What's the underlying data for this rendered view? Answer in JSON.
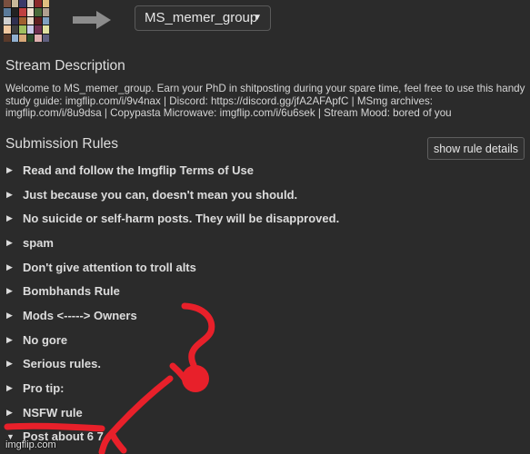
{
  "header": {
    "stream_name": "MS_memer_group"
  },
  "thumbnail_colors": [
    "#7a5040",
    "#c9b89a",
    "#3a3a6a",
    "#d8d0c0",
    "#8a2a2a",
    "#e0c080",
    "#5a7a9a",
    "#222",
    "#c04040",
    "#f0e0d0",
    "#4a6a3a",
    "#b0a090",
    "#d0d0d0",
    "#303050",
    "#a06030",
    "#e8d8c8",
    "#602020",
    "#80a0c0",
    "#f0c8a0",
    "#404040",
    "#a0c060",
    "#c8c8e8",
    "#703050",
    "#e0e0a0",
    "#5a3a2a",
    "#90b0d0",
    "#d8a878",
    "#2a4a2a",
    "#e0b0b0",
    "#606080"
  ],
  "description": {
    "title": "Stream Description",
    "text": "Welcome to MS_memer_group. Earn your PhD in shitposting during your spare time, feel free to use this handy study guide: imgflip.com/i/9v4nax | Discord: https://discord.gg/jfA2AFApfC | MSmg archives: imgflip.com/i/8u9dsa | Copypasta Microwave: imgflip.com/i/6u6sek | Stream Mood: bored of you"
  },
  "rules_section": {
    "title": "Submission Rules",
    "toggle_label": "show rule details",
    "items": [
      "Read and follow the Imgflip Terms of Use",
      "Just because you can, doesn't mean you should.",
      "No suicide or self-harm posts. They will be disapproved.",
      "spam",
      "Don't give attention to troll alts",
      "Bombhands Rule",
      "Mods <-----> Owners",
      "No gore",
      "Serious rules.",
      "Pro tip:",
      "NSFW rule",
      "Post about 6 7"
    ]
  },
  "watermark": "imgflip.com",
  "doodle_color": "#e8202a"
}
